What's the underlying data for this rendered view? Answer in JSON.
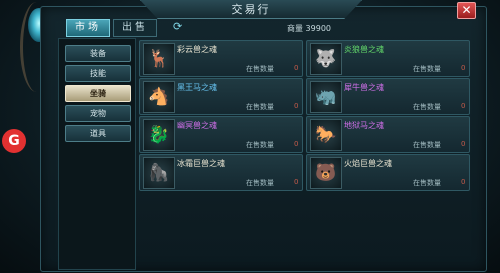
{
  "window": {
    "title": "交易行",
    "close_label": "✕"
  },
  "tabs": [
    {
      "label": "市场",
      "active": true
    },
    {
      "label": "出售",
      "active": false
    }
  ],
  "currency": {
    "label": "商量",
    "value": "39900"
  },
  "sidebar": {
    "items": [
      {
        "label": "装备",
        "active": false
      },
      {
        "label": "技能",
        "active": false
      },
      {
        "label": "坐骑",
        "active": true
      },
      {
        "label": "宠物",
        "active": false
      },
      {
        "label": "道具",
        "active": false
      }
    ]
  },
  "stock_label": "在售数量",
  "items": [
    {
      "name": "彩云兽之魂",
      "count": "0",
      "color": "#e8e3d0",
      "icon": "mount-icon",
      "glyph": "🦌"
    },
    {
      "name": "炎狼兽之魂",
      "count": "0",
      "color": "#63d86a",
      "icon": "mount-icon",
      "glyph": "🐺"
    },
    {
      "name": "黑王马之魂",
      "count": "0",
      "color": "#67c3f0",
      "icon": "mount-icon",
      "glyph": "🐴"
    },
    {
      "name": "犀牛兽之魂",
      "count": "0",
      "color": "#cf6fe8",
      "icon": "mount-icon",
      "glyph": "🦏"
    },
    {
      "name": "幽冥兽之魂",
      "count": "0",
      "color": "#cf6fe8",
      "icon": "mount-icon",
      "glyph": "🐉"
    },
    {
      "name": "地狱马之魂",
      "count": "0",
      "color": "#cf6fe8",
      "icon": "mount-icon",
      "glyph": "🐎"
    },
    {
      "name": "冰霜巨兽之魂",
      "count": "0",
      "color": "#e8e3d0",
      "icon": "mount-icon",
      "glyph": "🦍"
    },
    {
      "name": "火焰巨兽之魂",
      "count": "0",
      "color": "#e8e3d0",
      "icon": "mount-icon",
      "glyph": "🐻"
    }
  ],
  "side_logo": "G"
}
